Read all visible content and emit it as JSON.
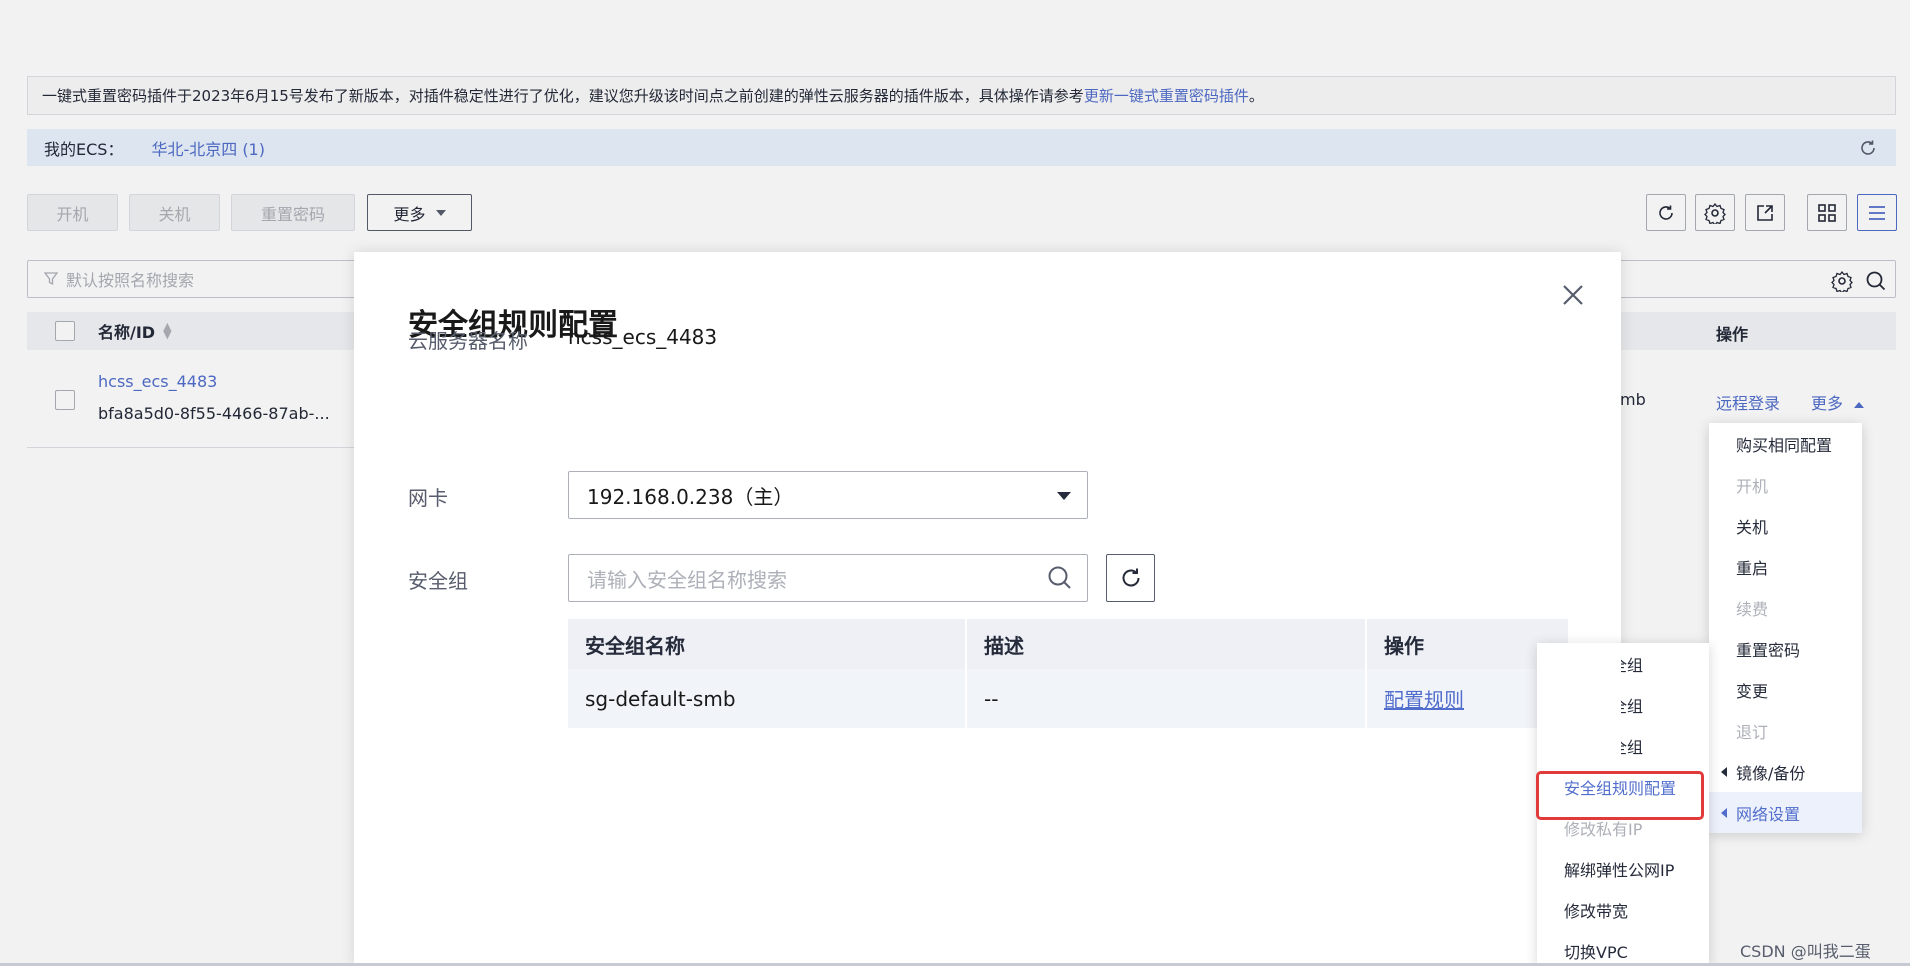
{
  "notice": {
    "text": "一键式重置密码插件于2023年6月15号发布了新版本，对插件稳定性进行了优化，建议您升级该时间点之前创建的弹性云服务器的插件版本，具体操作请参考",
    "link": "更新一键式重置密码插件",
    "suffix": "。"
  },
  "region_bar": {
    "label": "我的ECS：",
    "region": "华北-北京四 (1)"
  },
  "toolbar": {
    "start": "开机",
    "stop": "关机",
    "reset_password": "重置密码",
    "more": "更多"
  },
  "search": {
    "placeholder": "默认按照名称搜索"
  },
  "table": {
    "col_name": "名称/ID",
    "col_ops": "操作",
    "row": {
      "name": "hcss_ecs_4483",
      "id": "bfa8a5d0-8f55-4466-87ab-...",
      "partial": "mb",
      "remote_login": "远程登录",
      "more": "更多"
    }
  },
  "dialog": {
    "title": "安全组规则配置",
    "server_name_label": "云服务器名称",
    "server_name": "hcss_ecs_4483",
    "nic_label": "网卡",
    "nic_value": "192.168.0.238（主）",
    "sg_label": "安全组",
    "sg_placeholder": "请输入安全组名称搜索",
    "sg_table": {
      "headers": [
        "安全组名称",
        "描述",
        "操作"
      ],
      "rows": [
        {
          "name": "sg-default-smb",
          "desc": "--",
          "action": "配置规则"
        }
      ]
    }
  },
  "more_menu": {
    "items": [
      {
        "label": "购买相同配置",
        "state": "normal"
      },
      {
        "label": "开机",
        "state": "disabled"
      },
      {
        "label": "关机",
        "state": "normal"
      },
      {
        "label": "重启",
        "state": "normal"
      },
      {
        "label": "续费",
        "state": "disabled"
      },
      {
        "label": "重置密码",
        "state": "normal"
      },
      {
        "label": "变更",
        "state": "normal"
      },
      {
        "label": "退订",
        "state": "disabled"
      },
      {
        "label": "镜像/备份",
        "state": "submenu"
      },
      {
        "label": "网络设置",
        "state": "active-submenu"
      }
    ]
  },
  "network_menu": {
    "partial_items": [
      "全组",
      "全组",
      "全组"
    ],
    "items": [
      {
        "label": "安全组规则配置",
        "state": "selected"
      },
      {
        "label": "修改私有IP",
        "state": "disabled"
      },
      {
        "label": "解绑弹性公网IP",
        "state": "normal"
      },
      {
        "label": "修改带宽",
        "state": "normal"
      },
      {
        "label": "切换VPC",
        "state": "normal"
      }
    ]
  },
  "watermark": "CSDN @叫我二蛋",
  "colors": {
    "accent": "#526ecc",
    "highlight": "#e03a3a",
    "region_bg": "#e9f2fd"
  }
}
